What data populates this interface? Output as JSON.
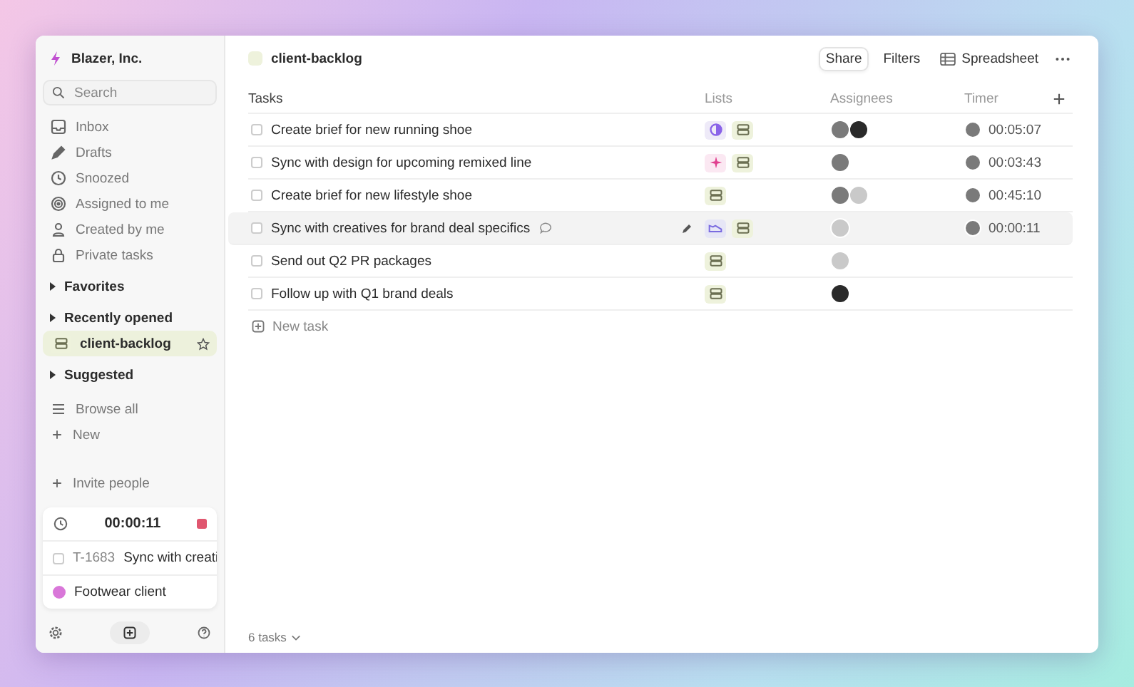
{
  "workspace": {
    "name": "Blazer, Inc."
  },
  "sidebar": {
    "search": {
      "placeholder": "Search"
    },
    "nav": [
      {
        "label": "Inbox",
        "kind": "inbox"
      },
      {
        "label": "Drafts",
        "kind": "pencil"
      },
      {
        "label": "Snoozed",
        "kind": "clock"
      },
      {
        "label": "Assigned to me",
        "kind": "target"
      },
      {
        "label": "Created by me",
        "kind": "person"
      },
      {
        "label": "Private tasks",
        "kind": "lock"
      }
    ],
    "sections": [
      {
        "label": "Favorites"
      },
      {
        "label": "Recently opened",
        "items": [
          {
            "label": "client-backlog",
            "selected": true
          }
        ]
      },
      {
        "label": "Suggested"
      }
    ],
    "actions": [
      {
        "label": "Browse all",
        "kind": "list"
      },
      {
        "label": "New",
        "kind": "plus"
      }
    ],
    "invite": "Invite people",
    "timer": {
      "time": "00:00:11",
      "checked": false,
      "task_id": "T-1683",
      "task_title": "Sync with creati",
      "project": "Footwear client"
    }
  },
  "header": {
    "title": "client-backlog",
    "buttons": [
      {
        "label": "Share",
        "kind": "outlined"
      },
      {
        "label": "Filters",
        "kind": "plain"
      },
      {
        "label": "Spreadsheet",
        "kind": "table"
      }
    ]
  },
  "table": {
    "columns": [
      "Tasks",
      "Lists",
      "Assignees",
      "Timer"
    ],
    "rows": [
      {
        "title": "Create brief for new running shoe",
        "checked": false,
        "highlighted": false,
        "comment": false,
        "lists": [
          {
            "kind": "circle"
          },
          {
            "kind": "stack"
          }
        ],
        "assignees": [
          {
            "kind": "medium"
          },
          {
            "kind": "dark"
          }
        ],
        "timer": "00:05:07"
      },
      {
        "title": "Sync with design for upcoming remixed line",
        "checked": false,
        "highlighted": false,
        "comment": false,
        "lists": [
          {
            "kind": "sparkle"
          },
          {
            "kind": "stack"
          }
        ],
        "assignees": [
          {
            "kind": "medium"
          }
        ],
        "timer": "00:03:43"
      },
      {
        "title": "Create brief for new lifestyle shoe",
        "checked": false,
        "highlighted": false,
        "comment": false,
        "lists": [
          {
            "kind": "stack"
          }
        ],
        "assignees": [
          {
            "kind": "medium"
          },
          {
            "kind": "light"
          }
        ],
        "timer": "00:45:10"
      },
      {
        "title": "Sync with creatives for brand deal specifics",
        "checked": false,
        "highlighted": true,
        "comment": true,
        "lists": [
          {
            "kind": "shoe"
          },
          {
            "kind": "stack"
          }
        ],
        "assignees": [
          {
            "kind": "light"
          }
        ],
        "timer": "00:00:11"
      },
      {
        "title": "Send out Q2 PR packages",
        "checked": false,
        "highlighted": false,
        "comment": false,
        "lists": [
          {
            "kind": "stack"
          }
        ],
        "assignees": [
          {
            "kind": "light"
          }
        ]
      },
      {
        "title": "Follow up with Q1 brand deals",
        "checked": false,
        "highlighted": false,
        "comment": false,
        "lists": [
          {
            "kind": "stack"
          }
        ],
        "assignees": [
          {
            "kind": "dark"
          }
        ]
      }
    ],
    "new_task": "New task"
  },
  "footer": {
    "count": "6 tasks"
  }
}
